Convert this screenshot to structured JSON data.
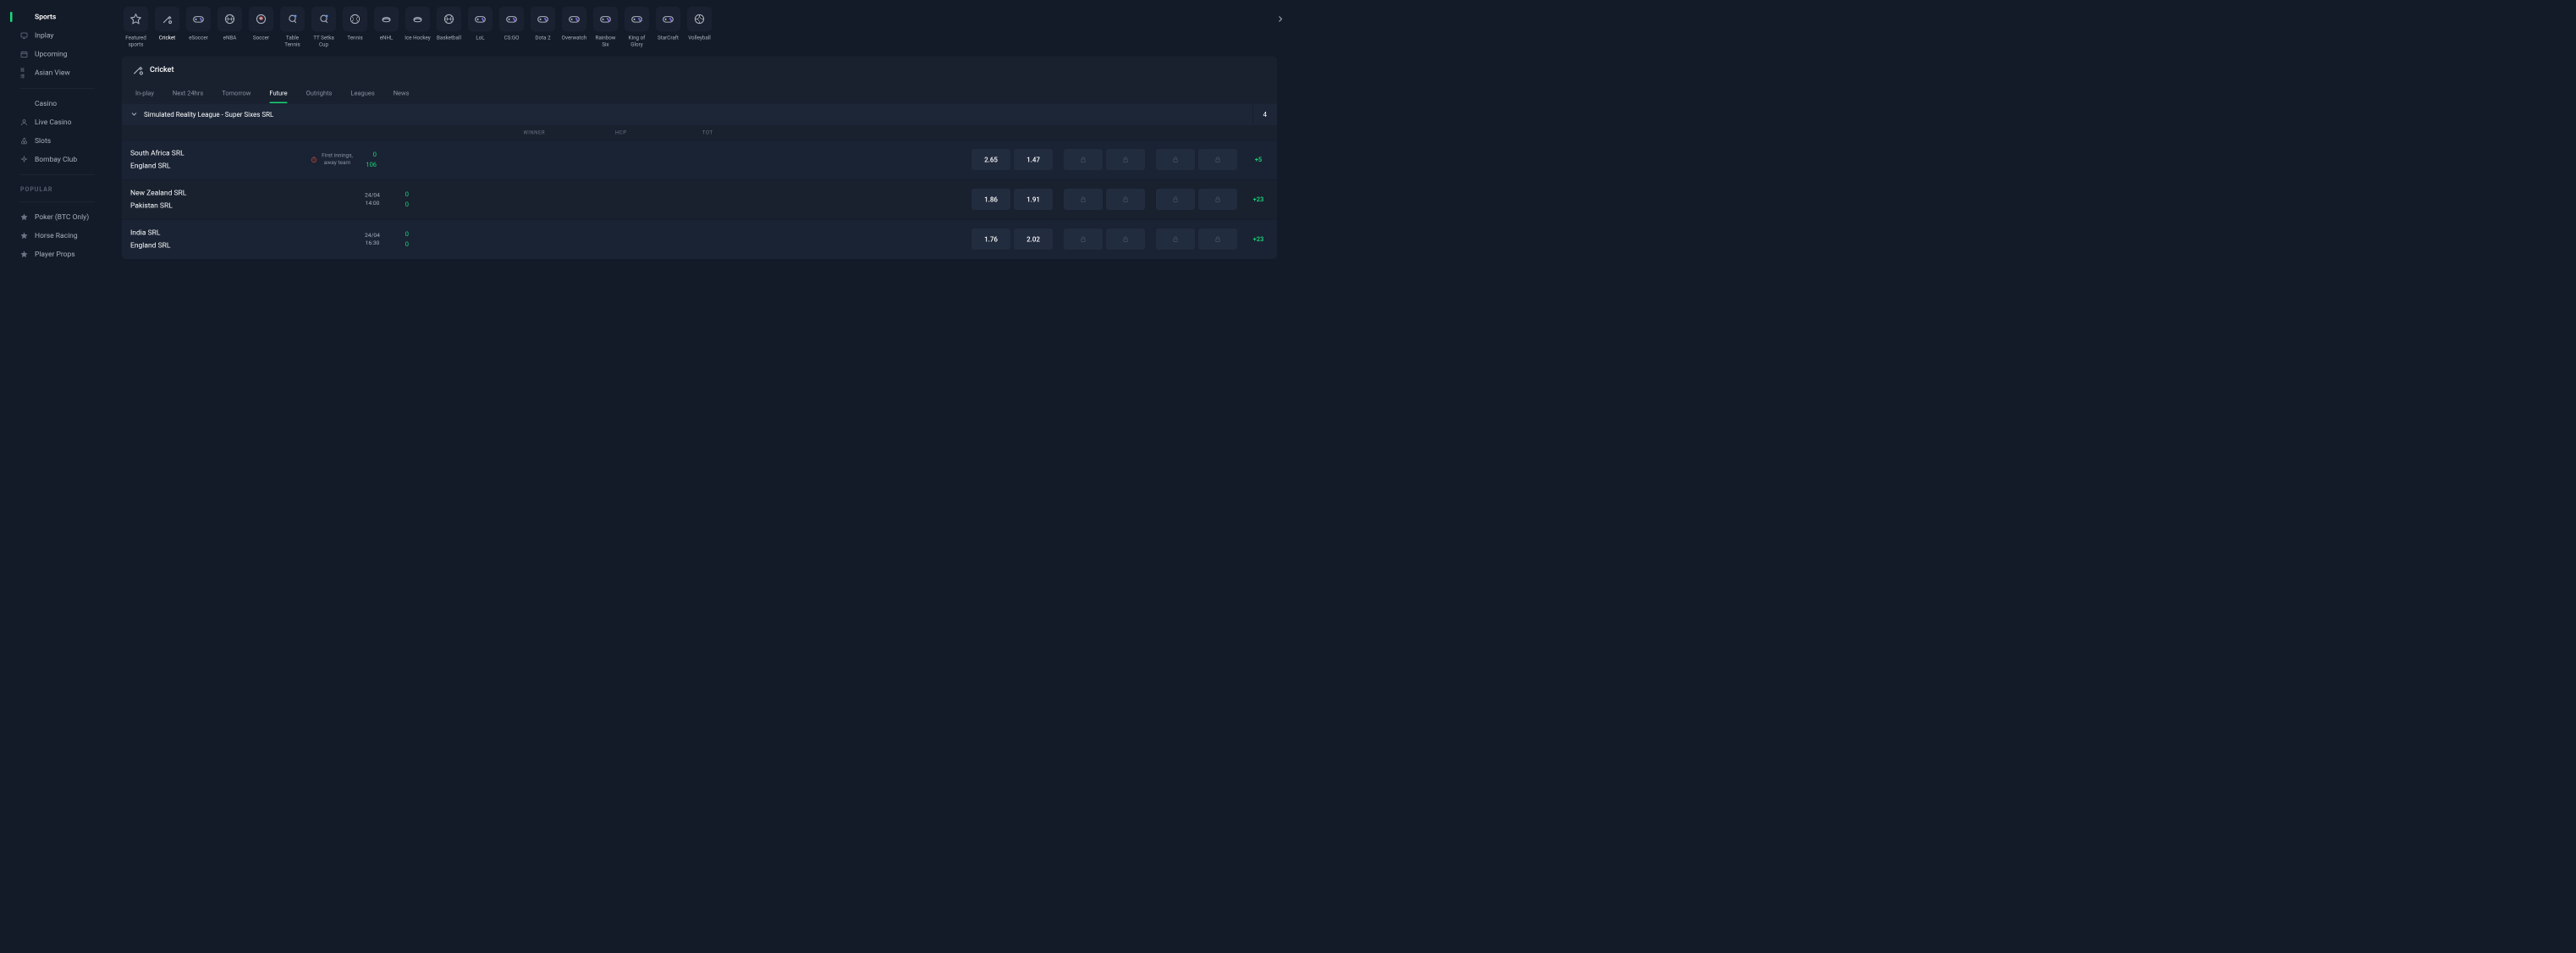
{
  "sidebar": {
    "items": [
      {
        "label": "Sports",
        "active": true,
        "icon": "none"
      },
      {
        "label": "Inplay",
        "icon": "monitor"
      },
      {
        "label": "Upcoming",
        "icon": "calendar"
      },
      {
        "label": "Asian View",
        "icon": "cjk"
      }
    ],
    "casino": [
      {
        "label": "Casino",
        "icon": "none"
      },
      {
        "label": "Live Casino",
        "icon": "dealer"
      },
      {
        "label": "Slots",
        "icon": "cherry"
      },
      {
        "label": "Bombay Club",
        "icon": "sparkle"
      }
    ],
    "popular_label": "POPULAR",
    "popular": [
      {
        "label": "Poker (BTC Only)",
        "icon": "star"
      },
      {
        "label": "Horse Racing",
        "icon": "star"
      },
      {
        "label": "Player Props",
        "icon": "star"
      }
    ]
  },
  "sports_strip": [
    {
      "label": "Featured sports",
      "icon": "star",
      "color": "c-green"
    },
    {
      "label": "Cricket",
      "icon": "cricket",
      "color": "c-orange",
      "selected": true
    },
    {
      "label": "eSoccer",
      "icon": "gamepad",
      "color": "c-purple"
    },
    {
      "label": "eNBA",
      "icon": "ball-lines",
      "color": "c-orange"
    },
    {
      "label": "Soccer",
      "icon": "soccer",
      "color": "c-red"
    },
    {
      "label": "Table Tennis",
      "icon": "pingpong",
      "color": "c-blue"
    },
    {
      "label": "TT Setka Cup",
      "icon": "pingpong",
      "color": "c-blue"
    },
    {
      "label": "Tennis",
      "icon": "tennis",
      "color": "c-yellow"
    },
    {
      "label": "eNHL",
      "icon": "puck",
      "color": "c-blue"
    },
    {
      "label": "Ice Hockey",
      "icon": "puck",
      "color": "c-blue"
    },
    {
      "label": "Basketball",
      "icon": "ball-lines",
      "color": "c-orange"
    },
    {
      "label": "LoL",
      "icon": "gamepad",
      "color": "c-purple"
    },
    {
      "label": "CS:GO",
      "icon": "gamepad",
      "color": "c-purple"
    },
    {
      "label": "Dota 2",
      "icon": "gamepad",
      "color": "c-purple"
    },
    {
      "label": "Overwatch",
      "icon": "gamepad",
      "color": "c-purple"
    },
    {
      "label": "Rainbow Six",
      "icon": "gamepad",
      "color": "c-purple"
    },
    {
      "label": "King of Glory",
      "icon": "gamepad",
      "color": "c-purple"
    },
    {
      "label": "StarCraft",
      "icon": "gamepad",
      "color": "c-purple"
    },
    {
      "label": "Volleyball",
      "icon": "volleyball",
      "color": "c-blue"
    }
  ],
  "panel": {
    "title": "Cricket",
    "tabs": [
      "In-play",
      "Next 24hrs",
      "Tomorrow",
      "Future",
      "Outrights",
      "Leagues",
      "News"
    ],
    "active_tab": "Future"
  },
  "league": {
    "name": "Simulated Reality League - Super Sixes SRL",
    "count": "4"
  },
  "market_headers": [
    "WINNER",
    "HCP",
    "TOT"
  ],
  "matches": [
    {
      "home": "South Africa SRL",
      "away": "England SRL",
      "live": true,
      "status": "First innings, away team",
      "score_home": "0",
      "score_away": "106",
      "odds": [
        "2.65",
        "1.47",
        "lock",
        "lock",
        "lock",
        "lock"
      ],
      "more": "+5"
    },
    {
      "home": "New Zealand SRL",
      "away": "Pakistan SRL",
      "date": "24/04",
      "time": "14:00",
      "score_home": "0",
      "score_away": "0",
      "odds": [
        "1.86",
        "1.91",
        "lock",
        "lock",
        "lock",
        "lock"
      ],
      "more": "+23"
    },
    {
      "home": "India SRL",
      "away": "England SRL",
      "date": "24/04",
      "time": "16:30",
      "score_home": "0",
      "score_away": "0",
      "odds": [
        "1.76",
        "2.02",
        "lock",
        "lock",
        "lock",
        "lock"
      ],
      "more": "+23"
    }
  ]
}
